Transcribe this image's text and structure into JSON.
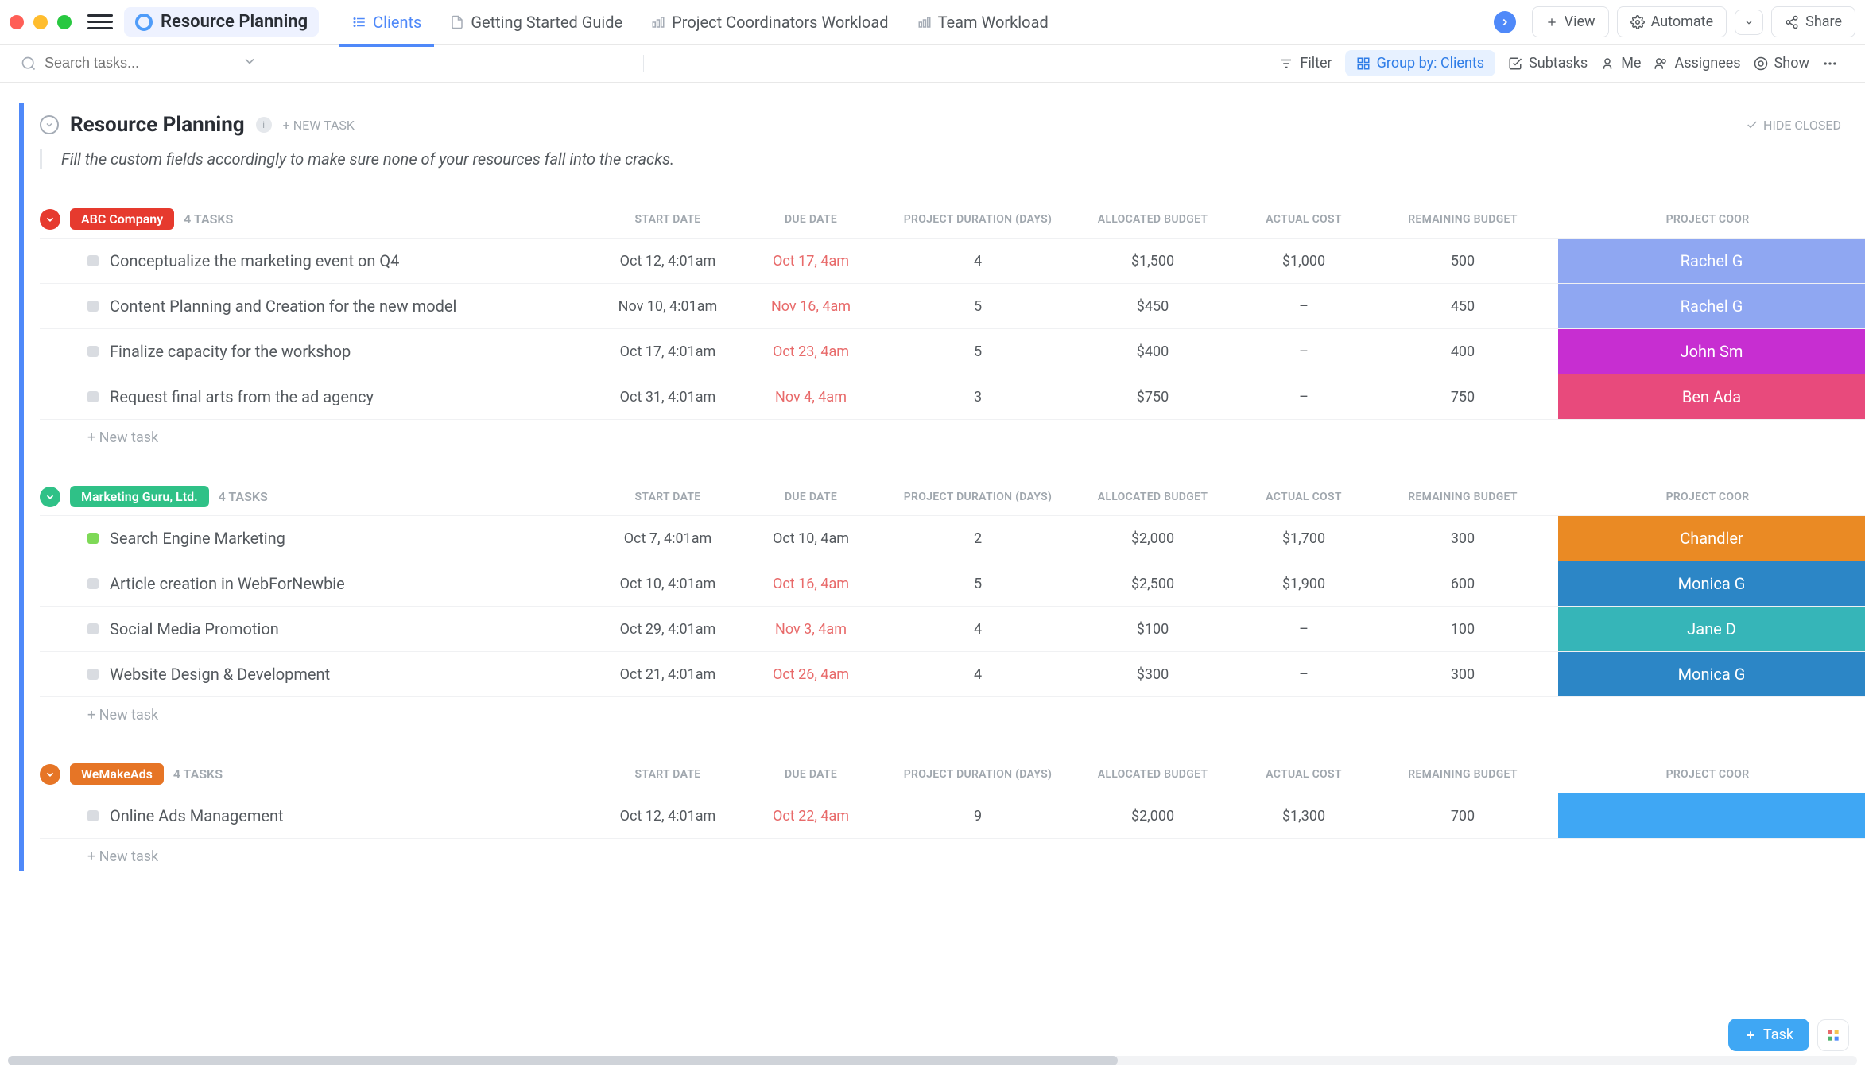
{
  "window": {
    "space_name": "Resource Planning",
    "tabs": [
      {
        "label": "Clients",
        "active": true,
        "icon": "list-pin"
      },
      {
        "label": "Getting Started Guide",
        "active": false,
        "icon": "doc-pin"
      },
      {
        "label": "Project Coordinators Workload",
        "active": false,
        "icon": "workload-pin"
      },
      {
        "label": "Team Workload",
        "active": false,
        "icon": "workload-pin"
      }
    ],
    "view_btn": "View",
    "automate_btn": "Automate",
    "share_btn": "Share"
  },
  "toolbar": {
    "search_placeholder": "Search tasks...",
    "filter": "Filter",
    "group_by": "Group by: Clients",
    "subtasks": "Subtasks",
    "me": "Me",
    "assignees": "Assignees",
    "show": "Show"
  },
  "section": {
    "title": "Resource Planning",
    "new_task": "+ NEW TASK",
    "hide_closed": "HIDE CLOSED",
    "description": "Fill the custom fields accordingly to make sure none of your resources fall into the cracks."
  },
  "columns": [
    "START DATE",
    "DUE DATE",
    "PROJECT DURATION (DAYS)",
    "ALLOCATED BUDGET",
    "ACTUAL COST",
    "REMAINING BUDGET",
    "PROJECT COOR"
  ],
  "groups": [
    {
      "client": "ABC Company",
      "color": "#e63a2e",
      "task_count": "4 TASKS",
      "tasks": [
        {
          "title": "Conceptualize the marketing event on Q4",
          "start": "Oct 12, 4:01am",
          "due": "Oct 17, 4am",
          "due_past": true,
          "duration": "4",
          "allocated": "$1,500",
          "actual": "$1,000",
          "remaining": "500",
          "coord": "Rachel G",
          "coord_color": "#8fa7f2",
          "status": "#d9dce1"
        },
        {
          "title": "Content Planning and Creation for the new model",
          "start": "Nov 10, 4:01am",
          "due": "Nov 16, 4am",
          "due_past": true,
          "duration": "5",
          "allocated": "$450",
          "actual": "–",
          "remaining": "450",
          "coord": "Rachel G",
          "coord_color": "#8fa7f2",
          "status": "#d9dce1"
        },
        {
          "title": "Finalize capacity for the workshop",
          "start": "Oct 17, 4:01am",
          "due": "Oct 23, 4am",
          "due_past": true,
          "duration": "5",
          "allocated": "$400",
          "actual": "–",
          "remaining": "400",
          "coord": "John Sm",
          "coord_color": "#c72ed1",
          "status": "#d9dce1"
        },
        {
          "title": "Request final arts from the ad agency",
          "start": "Oct 31, 4:01am",
          "due": "Nov 4, 4am",
          "due_past": true,
          "duration": "3",
          "allocated": "$750",
          "actual": "–",
          "remaining": "750",
          "coord": "Ben Ada",
          "coord_color": "#e84a7c",
          "status": "#d9dce1"
        }
      ],
      "new_task": "+ New task"
    },
    {
      "client": "Marketing Guru, Ltd.",
      "color": "#2fc187",
      "task_count": "4 TASKS",
      "tasks": [
        {
          "title": "Search Engine Marketing",
          "start": "Oct 7, 4:01am",
          "due": "Oct 10, 4am",
          "due_past": false,
          "duration": "2",
          "allocated": "$2,000",
          "actual": "$1,700",
          "remaining": "300",
          "coord": "Chandler",
          "coord_color": "#ea8a24",
          "status": "#7ed957"
        },
        {
          "title": "Article creation in WebForNewbie",
          "start": "Oct 10, 4:01am",
          "due": "Oct 16, 4am",
          "due_past": true,
          "duration": "5",
          "allocated": "$2,500",
          "actual": "$1,900",
          "remaining": "600",
          "coord": "Monica G",
          "coord_color": "#2c86c6",
          "status": "#d9dce1"
        },
        {
          "title": "Social Media Promotion",
          "start": "Oct 29, 4:01am",
          "due": "Nov 3, 4am",
          "due_past": true,
          "duration": "4",
          "allocated": "$100",
          "actual": "–",
          "remaining": "100",
          "coord": "Jane D",
          "coord_color": "#36b5b8",
          "status": "#d9dce1"
        },
        {
          "title": "Website Design & Development",
          "start": "Oct 21, 4:01am",
          "due": "Oct 26, 4am",
          "due_past": true,
          "duration": "4",
          "allocated": "$300",
          "actual": "–",
          "remaining": "300",
          "coord": "Monica G",
          "coord_color": "#2c86c6",
          "status": "#d9dce1"
        }
      ],
      "new_task": "+ New task"
    },
    {
      "client": "WeMakeAds",
      "color": "#e67526",
      "task_count": "4 TASKS",
      "tasks": [
        {
          "title": "Online Ads Management",
          "start": "Oct 12, 4:01am",
          "due": "Oct 22, 4am",
          "due_past": true,
          "duration": "9",
          "allocated": "$2,000",
          "actual": "$1,300",
          "remaining": "700",
          "coord": "",
          "coord_color": "#3fa7f4",
          "status": "#d9dce1"
        }
      ],
      "new_task": "+ New task"
    }
  ],
  "fab": {
    "task": "Task"
  }
}
